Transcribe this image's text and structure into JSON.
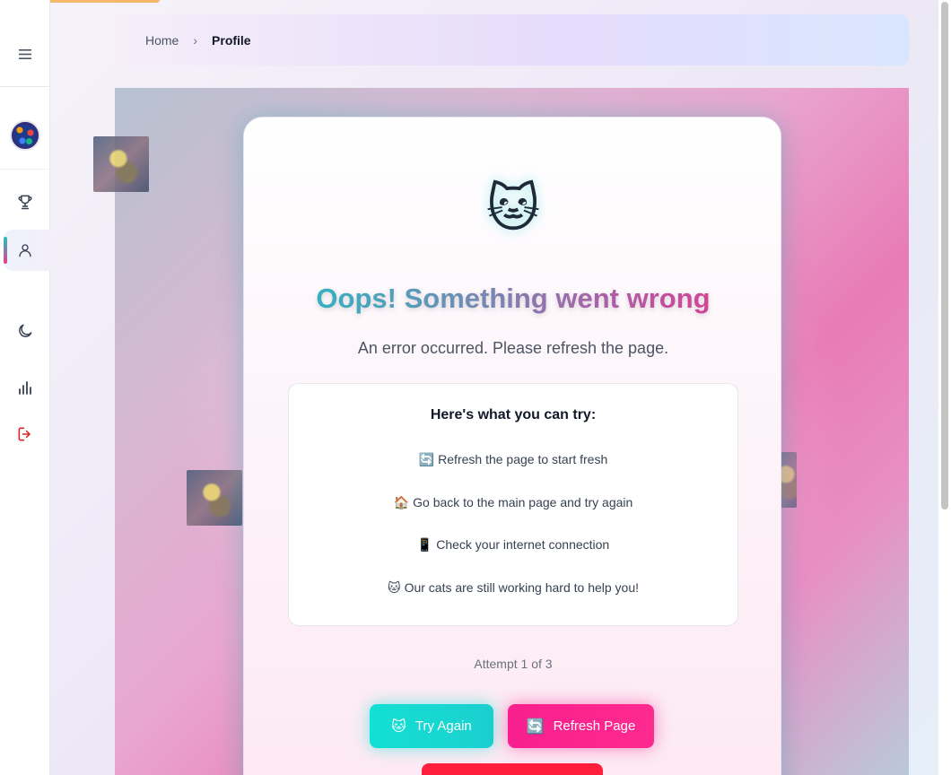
{
  "sidebar": {
    "icons": [
      "menu-icon",
      "trophy-icon",
      "user-icon",
      "moon-icon",
      "bar-chart-icon",
      "logout-icon"
    ],
    "active_item": "profile",
    "logout_color": "#dc2626"
  },
  "breadcrumb": {
    "home": "Home",
    "separator": "›",
    "current": "Profile"
  },
  "error_card": {
    "emoji": "🐱",
    "title": "Oops! Something went wrong",
    "subtitle": "An error occurred. Please refresh the page.",
    "tips_heading": "Here's what you can try:",
    "tips": [
      {
        "emoji": "🔄",
        "text": "Refresh the page to start fresh"
      },
      {
        "emoji": "🏠",
        "text": "Go back to the main page and try again"
      },
      {
        "emoji": "📱",
        "text": "Check your internet connection"
      },
      {
        "emoji": "🐱",
        "text": "Our cats are still working hard to help you!"
      }
    ],
    "attempt_text": "Attempt 1 of 3",
    "buttons": {
      "try_again": {
        "emoji": "🐱",
        "label": "Try Again",
        "color": "#12e0d4"
      },
      "refresh_page": {
        "emoji": "🔄",
        "label": "Refresh Page",
        "color": "#f81f8e"
      },
      "third_button_color": "#ff1e3c"
    }
  }
}
